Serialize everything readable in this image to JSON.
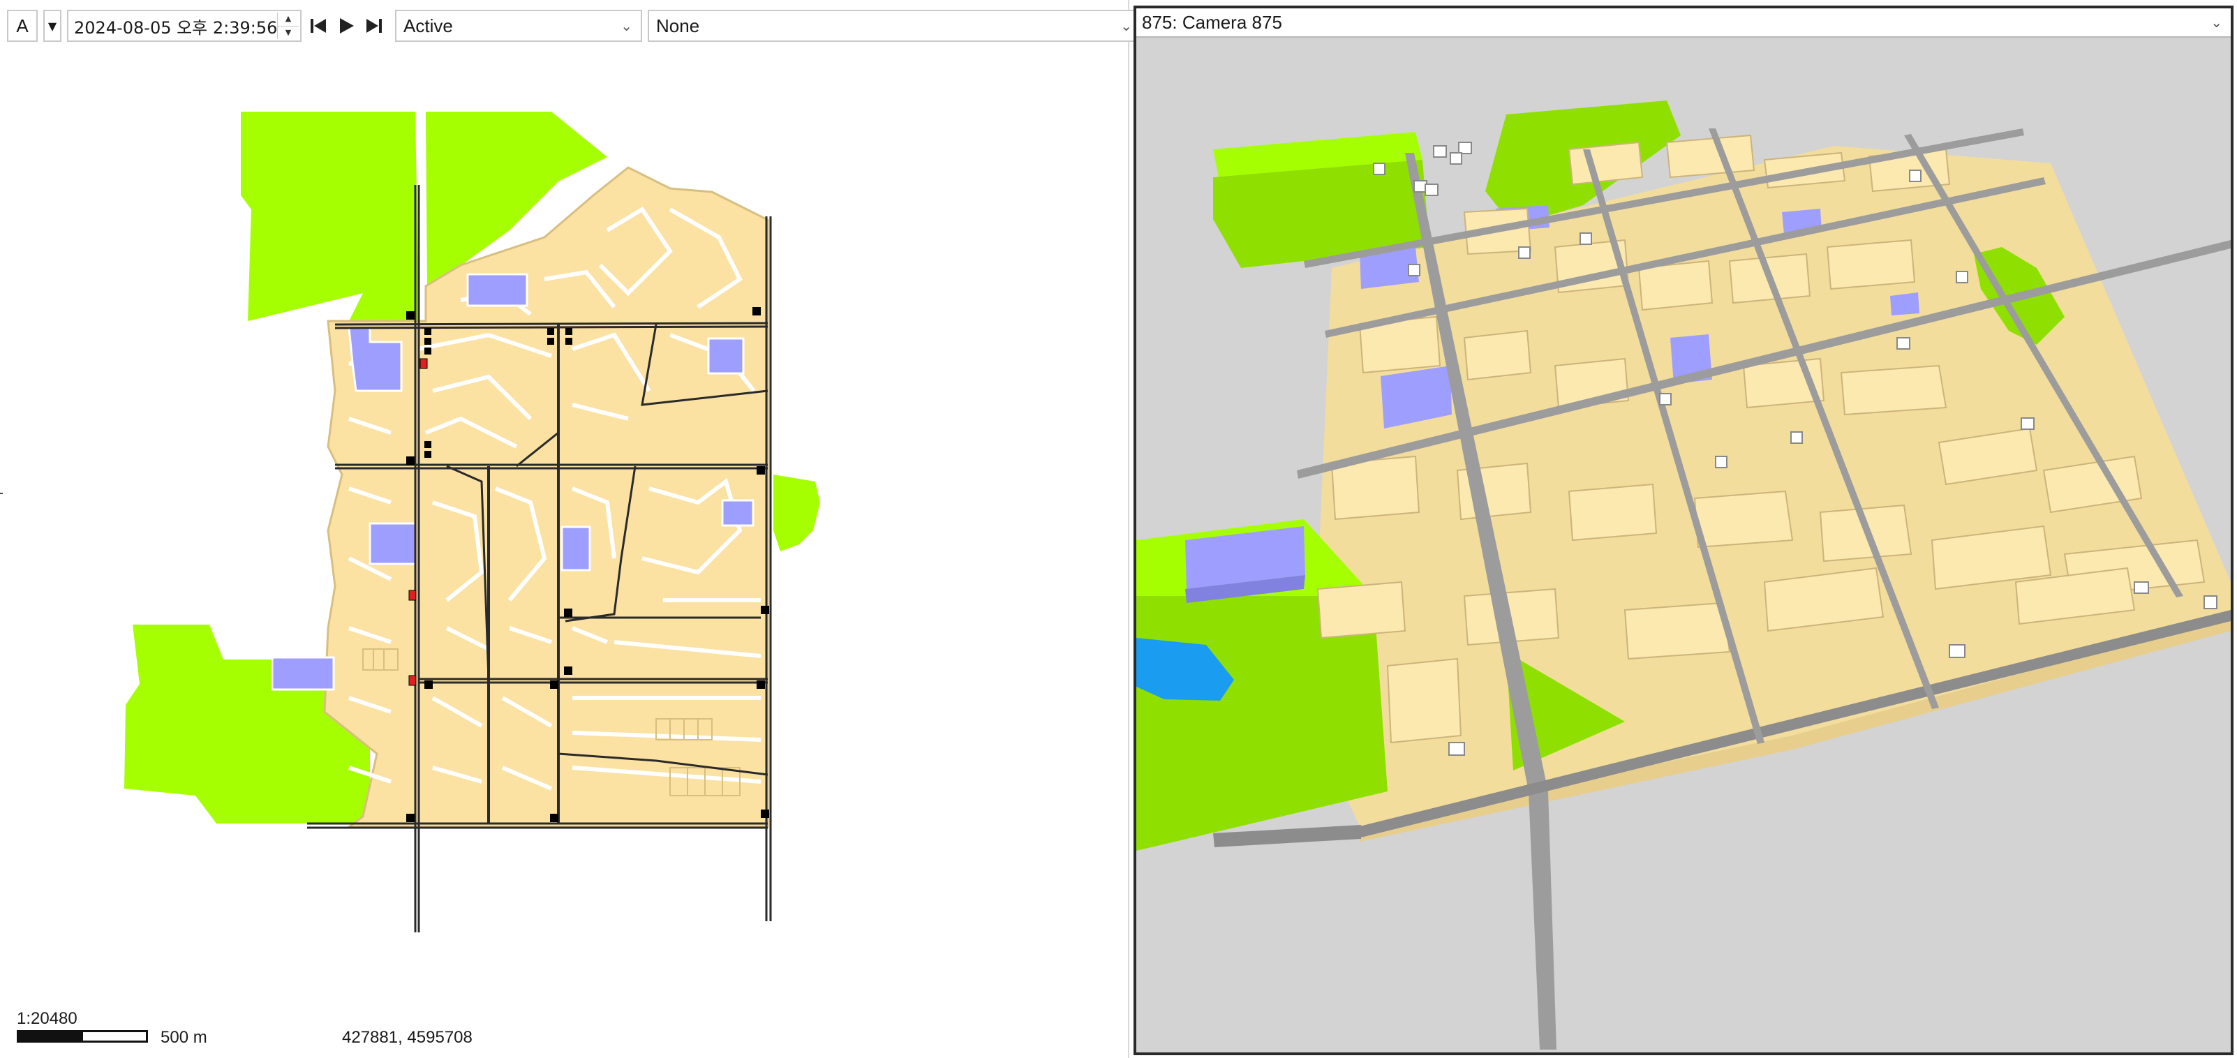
{
  "toolbar": {
    "mode_button": "A",
    "mode_dropdown_icon": "caret-down-icon",
    "datetime": "2024-08-05 오후 2:39:56",
    "nav_icons": [
      "skip-to-start-icon",
      "play-icon",
      "skip-to-end-icon"
    ],
    "status_select": "Active",
    "layer_select": "None"
  },
  "map_view": {
    "scale_ratio": "1:20480",
    "scale_length": "500 m",
    "coordinates": "427881, 4595708"
  },
  "scene_view": {
    "camera_select": "875: Camera 875"
  },
  "colors": {
    "park": "#a6ff00",
    "parcel": "#fbe1a2",
    "parcel_edge": "#d8bf80",
    "civic": "#9e9eff",
    "water": "#1a9cf0",
    "road": "#8c8c8c",
    "scene_background": "#d3d3d3",
    "marker": "#000000",
    "marker_alert": "#e02020"
  }
}
